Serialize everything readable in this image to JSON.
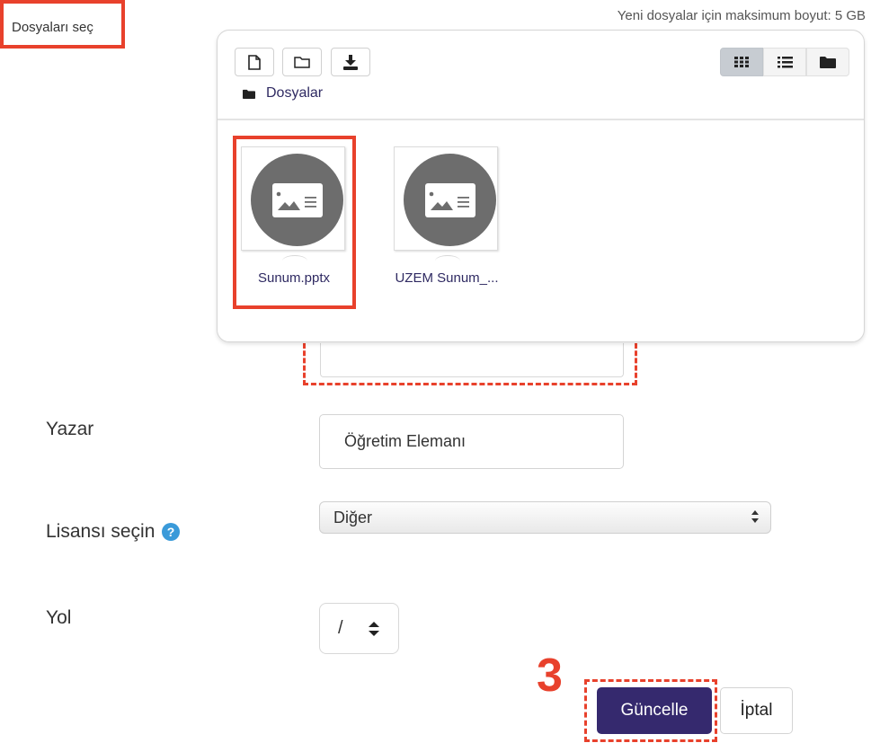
{
  "header": {
    "select_files_label": "Dosyaları seç",
    "max_size_note": "Yeni dosyalar için maksimum boyut: 5 GB"
  },
  "file_manager": {
    "toolbar": {
      "buttons": [
        "new-file-icon",
        "new-folder-icon",
        "download-icon"
      ],
      "views": [
        "grid-view-icon",
        "list-view-icon",
        "folder-view-icon"
      ],
      "active_view": "grid"
    },
    "breadcrumb": "Dosyalar",
    "files": [
      {
        "name": "Sunum.pptx",
        "icon": "presentation-file-icon",
        "selected": true
      },
      {
        "name": "UZEM Sunum_...",
        "icon": "presentation-file-icon",
        "selected": false
      }
    ]
  },
  "form": {
    "author_label": "Yazar",
    "author_value": "Öğretim Elemanı",
    "license_label": "Lisansı seçin",
    "license_value": "Diğer",
    "path_label": "Yol",
    "path_value": "/"
  },
  "actions": {
    "step_number": "3",
    "update_label": "Güncelle",
    "cancel_label": "İptal"
  },
  "colors": {
    "highlight": "#e8412c",
    "primary_button": "#35296e",
    "link_text": "#2f2a62",
    "help_icon": "#3a9ad9"
  }
}
